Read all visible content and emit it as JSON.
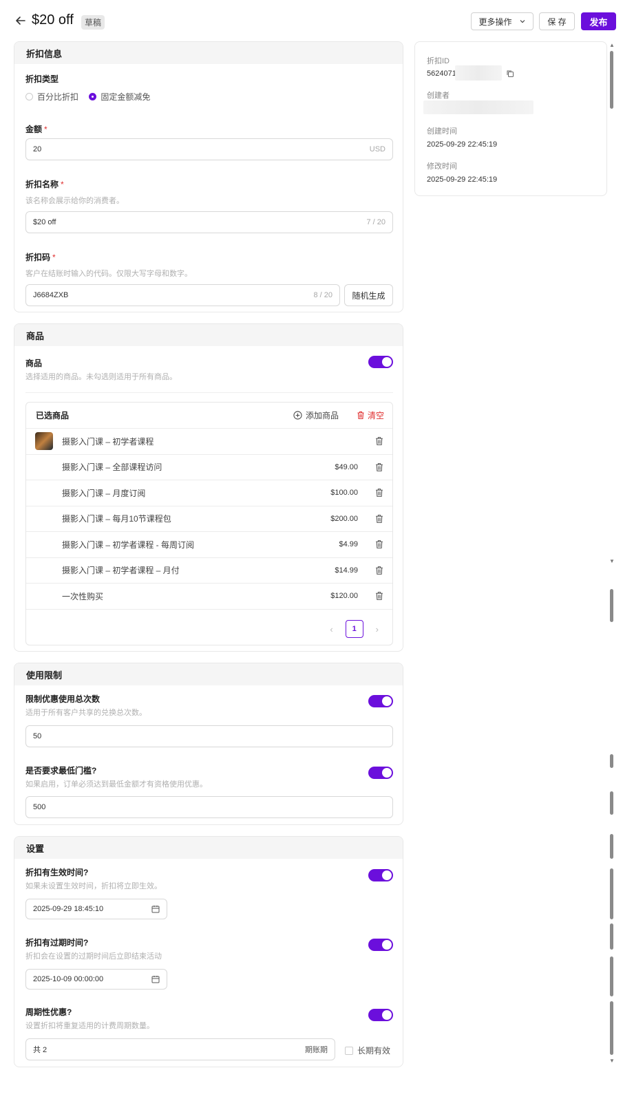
{
  "header": {
    "title": "$20 off",
    "badge": "草稿",
    "more_actions": "更多操作",
    "save": "保 存",
    "publish": "发布"
  },
  "discount_info": {
    "heading": "折扣信息",
    "type_label": "折扣类型",
    "type_options": [
      "百分比折扣",
      "固定金额减免"
    ],
    "type_selected": "固定金额减免",
    "amount_label": "金额",
    "amount_value": "20",
    "amount_suffix": "USD",
    "name_label": "折扣名称",
    "name_hint": "该名称会展示给你的消费者。",
    "name_value": "$20 off",
    "name_count": "7 / 20",
    "code_label": "折扣码",
    "code_hint": "客户在结账时输入的代码。仅限大写字母和数字。",
    "code_value": "J6684ZXB",
    "code_count": "8 / 20",
    "random_button": "随机生成"
  },
  "products": {
    "heading": "商品",
    "label": "商品",
    "hint": "选择适用的商品。未勾选则适用于所有商品。",
    "enabled": true,
    "selected_title": "已选商品",
    "add_button": "添加商品",
    "clear_button": "清空",
    "rows": [
      {
        "name": "摄影入门课 – 初学者课程",
        "price": ""
      },
      {
        "name": "摄影入门课 – 全部课程访问",
        "price": "$49.00"
      },
      {
        "name": "摄影入门课 – 月度订阅",
        "price": "$100.00"
      },
      {
        "name": "摄影入门课 – 每月10节课程包",
        "price": "$200.00"
      },
      {
        "name": "摄影入门课 – 初学者课程 - 每周订阅",
        "price": "$4.99"
      },
      {
        "name": "摄影入门课 – 初学者课程 – 月付",
        "price": "$14.99"
      },
      {
        "name": "一次性购买",
        "price": "$120.00"
      }
    ],
    "page": "1"
  },
  "usage": {
    "heading": "使用限制",
    "total_label": "限制优惠使用总次数",
    "total_hint": "适用于所有客户共享的兑换总次数。",
    "total_value": "50",
    "min_label": "是否要求最低门槛?",
    "min_hint": "如果启用，订单必须达到最低金额才有资格使用优惠。",
    "min_value": "500"
  },
  "settings": {
    "heading": "设置",
    "start_label": "折扣有生效时间?",
    "start_hint": "如果未设置生效时间，折扣将立即生效。",
    "start_value": "2025-09-29 18:45:10",
    "expire_label": "折扣有过期时间?",
    "expire_hint": "折扣会在设置的过期时间后立即结束活动",
    "expire_value": "2025-10-09 00:00:00",
    "recurring_label": "周期性优惠?",
    "recurring_hint": "设置折扣将重复适用的计费周期数量。",
    "recurring_value": "共 2",
    "recurring_suffix": "期账期",
    "forever_label": "长期有效"
  },
  "side": {
    "id_label": "折扣ID",
    "id_value": "5624071",
    "creator_label": "创建者",
    "created_label": "创建时间",
    "created_value": "2025-09-29 22:45:19",
    "modified_label": "修改时间",
    "modified_value": "2025-09-29 22:45:19"
  },
  "colors": {
    "accent": "#6b0fdc",
    "danger": "#e03030"
  }
}
